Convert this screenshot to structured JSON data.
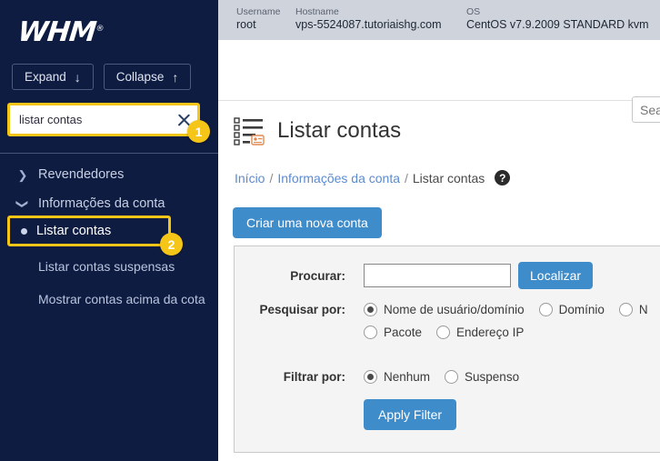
{
  "sidebar": {
    "logo": "WHM",
    "logo_mark": "®",
    "expand_label": "Expand",
    "expand_icon": "↓",
    "collapse_label": "Collapse",
    "collapse_icon": "↑",
    "search": {
      "value": "listar contas",
      "placeholder": "",
      "clear_icon": "close-icon"
    },
    "menu": [
      {
        "label": "Revendedores",
        "icon": "chevron-right-icon",
        "expanded": false
      },
      {
        "label": "Informações da conta",
        "icon": "chevron-down-icon",
        "expanded": true
      }
    ],
    "active_item": "Listar contas",
    "children": [
      "Listar contas suspensas",
      "Mostrar contas acima da cota"
    ],
    "annotations": [
      {
        "number": "1"
      },
      {
        "number": "2"
      }
    ],
    "highlight_color": "#f5c518",
    "background_color": "#0e1c42"
  },
  "header": {
    "username_label": "Username",
    "username_value": "root",
    "hostname_label": "Hostname",
    "hostname_value": "vps-5524087.tutoriaishg.com",
    "os_label": "OS",
    "os_value": "CentOS v7.9.2009 STANDARD kvm",
    "top_search_placeholder": "Search"
  },
  "page": {
    "title": "Listar contas",
    "title_icon": "list-accounts-icon",
    "breadcrumb": {
      "home": "Início",
      "section": "Informações da conta",
      "current": "Listar contas",
      "separator": "/",
      "help_icon": "?"
    },
    "create_account_button": "Criar uma nova conta"
  },
  "form": {
    "search_label": "Procurar:",
    "search_value": "",
    "search_button": "Localizar",
    "search_by_label": "Pesquisar por:",
    "search_by_options": [
      {
        "label": "Nome de usuário/domínio",
        "checked": true
      },
      {
        "label": "Domínio",
        "checked": false
      },
      {
        "label": "N",
        "checked": false
      },
      {
        "label": "Pacote",
        "checked": false
      },
      {
        "label": "Endereço IP",
        "checked": false
      }
    ],
    "filter_by_label": "Filtrar por:",
    "filter_by_options": [
      {
        "label": "Nenhum",
        "checked": true
      },
      {
        "label": "Suspenso",
        "checked": false
      }
    ],
    "apply_filter_button": "Apply Filter"
  },
  "colors": {
    "accent_blue": "#3f8ccb",
    "sidebar_navy": "#0e1c42",
    "highlight_gold": "#f5c518",
    "link_blue": "#5b8bd0"
  }
}
